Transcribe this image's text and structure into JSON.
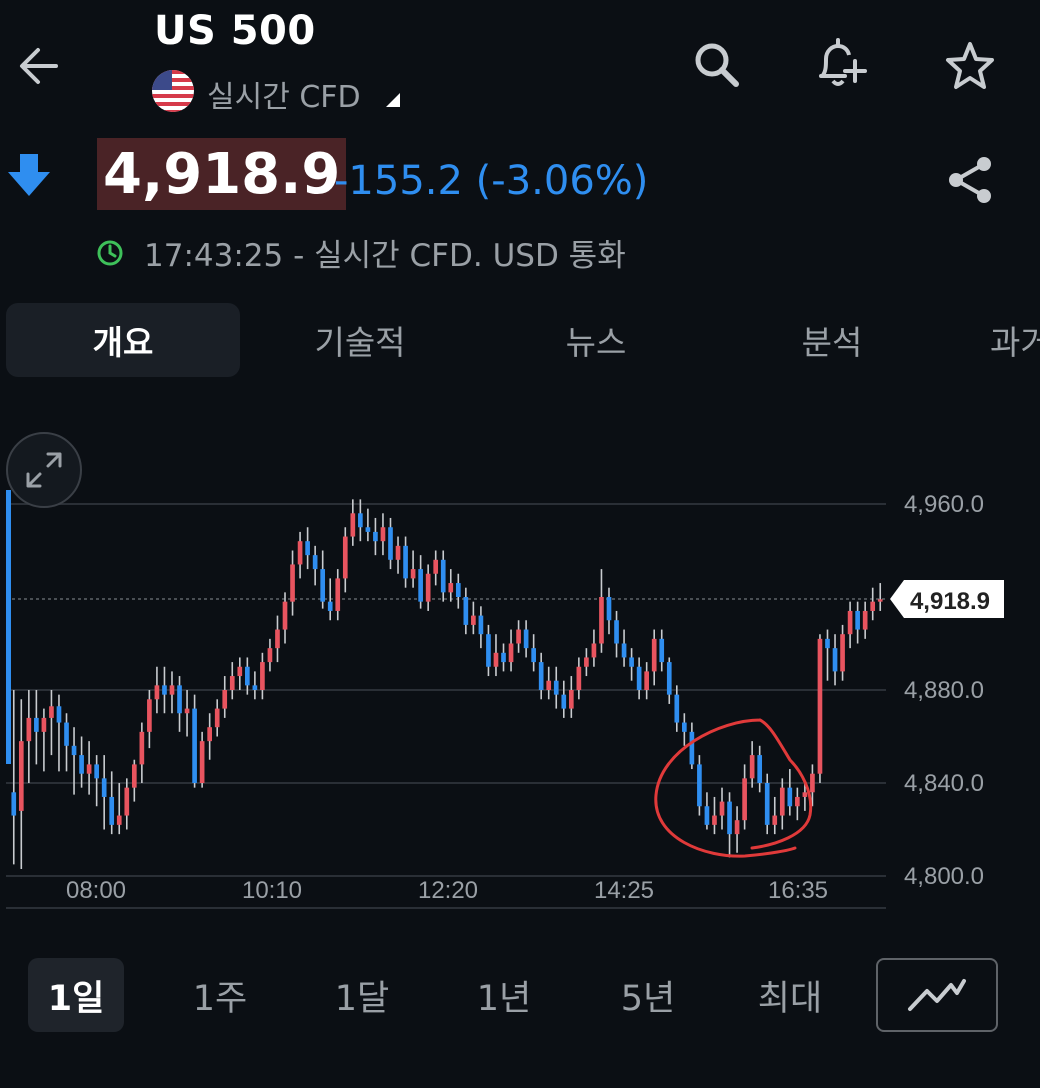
{
  "header": {
    "title": "US 500",
    "subtitle": "실시간 CFD",
    "icons": [
      "back-arrow-icon",
      "search-icon",
      "add-alert-icon",
      "star-icon",
      "share-icon"
    ]
  },
  "quote": {
    "price": "4,918.9",
    "change": "-155.2 (-3.06%)",
    "time_info": "17:43:25 - 실시간 CFD. USD 통화",
    "direction": "down",
    "colors": {
      "down": "#2f8ef0",
      "up": "#e8545f",
      "price_bg": "#4a2326"
    }
  },
  "tabs": [
    {
      "label": "개요",
      "active": true
    },
    {
      "label": "기술적",
      "active": false
    },
    {
      "label": "뉴스",
      "active": false
    },
    {
      "label": "분석",
      "active": false
    },
    {
      "label": "과거",
      "active": false
    }
  ],
  "chart_data": {
    "type": "candlestick",
    "y_ticks": [
      "4,960.0",
      "4,880.0",
      "4,840.0",
      "4,800.0"
    ],
    "x_ticks": [
      "08:00",
      "10:10",
      "12:20",
      "14:25",
      "16:35"
    ],
    "last_price_label": "4,918.9",
    "ylim": [
      4800,
      4960
    ],
    "grid": true,
    "colors": {
      "up": "#e8545f",
      "down": "#2f8ef0",
      "grid": "#2a2f36",
      "annotation": "#e03a3a"
    },
    "candles": [
      [
        4836,
        4826,
        4880,
        4805
      ],
      [
        4828,
        4858,
        4876,
        4803
      ],
      [
        4858,
        4868,
        4880,
        4840
      ],
      [
        4868,
        4862,
        4880,
        4848
      ],
      [
        4862,
        4868,
        4872,
        4845
      ],
      [
        4868,
        4873,
        4880,
        4852
      ],
      [
        4873,
        4866,
        4878,
        4845
      ],
      [
        4866,
        4856,
        4870,
        4845
      ],
      [
        4856,
        4852,
        4864,
        4835
      ],
      [
        4852,
        4844,
        4860,
        4838
      ],
      [
        4844,
        4848,
        4858,
        4835
      ],
      [
        4848,
        4842,
        4852,
        4830
      ],
      [
        4842,
        4834,
        4852,
        4820
      ],
      [
        4834,
        4822,
        4845,
        4818
      ],
      [
        4822,
        4826,
        4840,
        4818
      ],
      [
        4826,
        4838,
        4842,
        4820
      ],
      [
        4838,
        4848,
        4850,
        4832
      ],
      [
        4848,
        4862,
        4866,
        4840
      ],
      [
        4862,
        4876,
        4880,
        4855
      ],
      [
        4876,
        4882,
        4890,
        4870
      ],
      [
        4882,
        4878,
        4890,
        4870
      ],
      [
        4878,
        4882,
        4888,
        4870
      ],
      [
        4882,
        4870,
        4886,
        4862
      ],
      [
        4870,
        4872,
        4880,
        4860
      ],
      [
        4872,
        4840,
        4878,
        4838
      ],
      [
        4840,
        4858,
        4862,
        4838
      ],
      [
        4858,
        4864,
        4870,
        4850
      ],
      [
        4864,
        4872,
        4876,
        4860
      ],
      [
        4872,
        4880,
        4886,
        4868
      ],
      [
        4880,
        4886,
        4892,
        4876
      ],
      [
        4886,
        4890,
        4894,
        4880
      ],
      [
        4890,
        4882,
        4894,
        4878
      ],
      [
        4882,
        4880,
        4888,
        4876
      ],
      [
        4880,
        4892,
        4896,
        4876
      ],
      [
        4892,
        4898,
        4902,
        4888
      ],
      [
        4898,
        4906,
        4912,
        4892
      ],
      [
        4906,
        4918,
        4922,
        4900
      ],
      [
        4918,
        4934,
        4940,
        4912
      ],
      [
        4934,
        4944,
        4948,
        4928
      ],
      [
        4944,
        4938,
        4950,
        4932
      ],
      [
        4938,
        4932,
        4942,
        4925
      ],
      [
        4932,
        4918,
        4940,
        4915
      ],
      [
        4918,
        4914,
        4928,
        4910
      ],
      [
        4914,
        4928,
        4932,
        4910
      ],
      [
        4928,
        4946,
        4950,
        4922
      ],
      [
        4946,
        4956,
        4962,
        4942
      ],
      [
        4956,
        4950,
        4962,
        4944
      ],
      [
        4950,
        4948,
        4958,
        4944
      ],
      [
        4948,
        4944,
        4954,
        4938
      ],
      [
        4944,
        4950,
        4956,
        4938
      ],
      [
        4950,
        4936,
        4954,
        4932
      ],
      [
        4936,
        4942,
        4946,
        4930
      ],
      [
        4942,
        4928,
        4946,
        4924
      ],
      [
        4928,
        4932,
        4940,
        4924
      ],
      [
        4932,
        4918,
        4938,
        4915
      ],
      [
        4918,
        4930,
        4934,
        4914
      ],
      [
        4930,
        4936,
        4940,
        4925
      ],
      [
        4936,
        4922,
        4940,
        4918
      ],
      [
        4922,
        4926,
        4932,
        4918
      ],
      [
        4926,
        4920,
        4930,
        4915
      ],
      [
        4920,
        4908,
        4924,
        4904
      ],
      [
        4908,
        4912,
        4918,
        4904
      ],
      [
        4912,
        4904,
        4916,
        4898
      ],
      [
        4904,
        4890,
        4908,
        4886
      ],
      [
        4890,
        4896,
        4904,
        4886
      ],
      [
        4896,
        4892,
        4900,
        4888
      ],
      [
        4892,
        4900,
        4906,
        4888
      ],
      [
        4900,
        4906,
        4910,
        4896
      ],
      [
        4906,
        4898,
        4910,
        4894
      ],
      [
        4898,
        4892,
        4904,
        4888
      ],
      [
        4892,
        4880,
        4896,
        4876
      ],
      [
        4880,
        4884,
        4890,
        4876
      ],
      [
        4884,
        4878,
        4890,
        4872
      ],
      [
        4878,
        4872,
        4884,
        4868
      ],
      [
        4872,
        4880,
        4886,
        4868
      ],
      [
        4880,
        4890,
        4894,
        4876
      ],
      [
        4890,
        4894,
        4898,
        4886
      ],
      [
        4894,
        4900,
        4906,
        4890
      ],
      [
        4900,
        4920,
        4932,
        4896
      ],
      [
        4920,
        4910,
        4924,
        4904
      ],
      [
        4910,
        4900,
        4914,
        4894
      ],
      [
        4900,
        4894,
        4906,
        4890
      ],
      [
        4894,
        4890,
        4898,
        4884
      ],
      [
        4890,
        4880,
        4894,
        4876
      ],
      [
        4880,
        4888,
        4892,
        4876
      ],
      [
        4888,
        4902,
        4906,
        4882
      ],
      [
        4902,
        4892,
        4906,
        4888
      ],
      [
        4892,
        4878,
        4894,
        4874
      ],
      [
        4878,
        4866,
        4882,
        4862
      ],
      [
        4866,
        4862,
        4870,
        4856
      ],
      [
        4862,
        4848,
        4866,
        4846
      ],
      [
        4848,
        4830,
        4852,
        4826
      ],
      [
        4830,
        4822,
        4836,
        4820
      ],
      [
        4822,
        4826,
        4834,
        4818
      ],
      [
        4826,
        4832,
        4838,
        4820
      ],
      [
        4832,
        4818,
        4836,
        4808
      ],
      [
        4818,
        4824,
        4830,
        4810
      ],
      [
        4824,
        4842,
        4848,
        4820
      ],
      [
        4842,
        4852,
        4858,
        4838
      ],
      [
        4852,
        4840,
        4856,
        4836
      ],
      [
        4840,
        4822,
        4844,
        4818
      ],
      [
        4822,
        4826,
        4834,
        4818
      ],
      [
        4826,
        4838,
        4842,
        4820
      ],
      [
        4838,
        4830,
        4846,
        4826
      ],
      [
        4830,
        4834,
        4838,
        4824
      ],
      [
        4834,
        4836,
        4840,
        4828
      ],
      [
        4836,
        4844,
        4848,
        4830
      ],
      [
        4844,
        4902,
        4904,
        4840
      ],
      [
        4902,
        4898,
        4906,
        4884
      ],
      [
        4898,
        4888,
        4904,
        4882
      ],
      [
        4888,
        4904,
        4908,
        4884
      ],
      [
        4904,
        4914,
        4918,
        4898
      ],
      [
        4914,
        4906,
        4918,
        4900
      ],
      [
        4906,
        4914,
        4918,
        4902
      ],
      [
        4914,
        4918,
        4924,
        4910
      ],
      [
        4918,
        4919,
        4926,
        4914
      ]
    ]
  },
  "ranges": [
    {
      "label": "1일",
      "active": true
    },
    {
      "label": "1주",
      "active": false
    },
    {
      "label": "1달",
      "active": false
    },
    {
      "label": "1년",
      "active": false
    },
    {
      "label": "5년",
      "active": false
    },
    {
      "label": "최대",
      "active": false
    }
  ]
}
